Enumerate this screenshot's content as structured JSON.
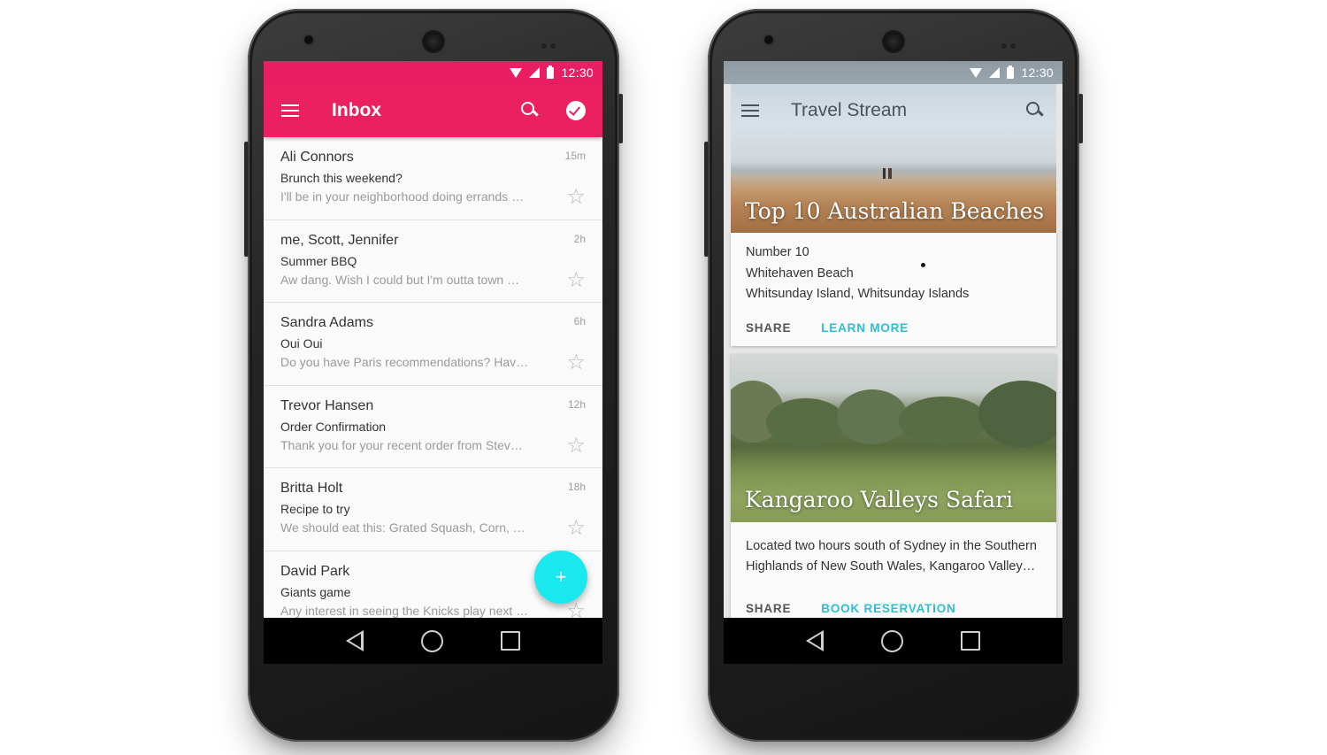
{
  "status_bar": {
    "time": "12:30"
  },
  "inbox_app": {
    "title": "Inbox",
    "colors": {
      "toolbar": "#EA2060",
      "status": "#E91E63",
      "fab": "#19E8EE"
    },
    "fab_label": "+",
    "emails": [
      {
        "sender": "Ali Connors",
        "subject": "Brunch this weekend?",
        "preview": "I'll be in your neighborhood doing errands …",
        "time": "15m"
      },
      {
        "sender": "me, Scott, Jennifer",
        "subject": "Summer BBQ",
        "preview": "Aw dang. Wish I could but I'm outta town …",
        "time": "2h"
      },
      {
        "sender": "Sandra Adams",
        "subject": "Oui Oui",
        "preview": "Do you have Paris recommendations? Hav…",
        "time": "6h"
      },
      {
        "sender": "Trevor Hansen",
        "subject": "Order Confirmation",
        "preview": "Thank you for your recent order from Stev…",
        "time": "12h"
      },
      {
        "sender": "Britta Holt",
        "subject": "Recipe to try",
        "preview": "We should eat this: Grated Squash, Corn, …",
        "time": "18h"
      },
      {
        "sender": "David Park",
        "subject": "Giants game",
        "preview": "Any interest in seeing the Knicks play next …",
        "time": ""
      }
    ]
  },
  "travel_app": {
    "title": "Travel Stream",
    "colors": {
      "accent": "#2EBDD2"
    },
    "cards": [
      {
        "image_title": "Top 10 Australian Beaches",
        "lines": [
          "Number 10",
          "Whitehaven Beach",
          "Whitsunday Island, Whitsunday Islands"
        ],
        "actions": [
          "SHARE",
          "LEARN MORE"
        ]
      },
      {
        "image_title": "Kangaroo Valleys Safari",
        "description": "Located two hours south of Sydney in the Southern Highlands of New South Wales, Kangaroo Valley…",
        "actions": [
          "SHARE",
          "BOOK RESERVATION"
        ]
      }
    ]
  },
  "icons": {
    "menu": "menu-icon",
    "search": "search-icon",
    "done": "check-circle-icon",
    "star": "star-outline-icon",
    "nav_back": "back-triangle-icon",
    "nav_home": "home-circle-icon",
    "nav_recent": "recent-apps-square-icon"
  }
}
